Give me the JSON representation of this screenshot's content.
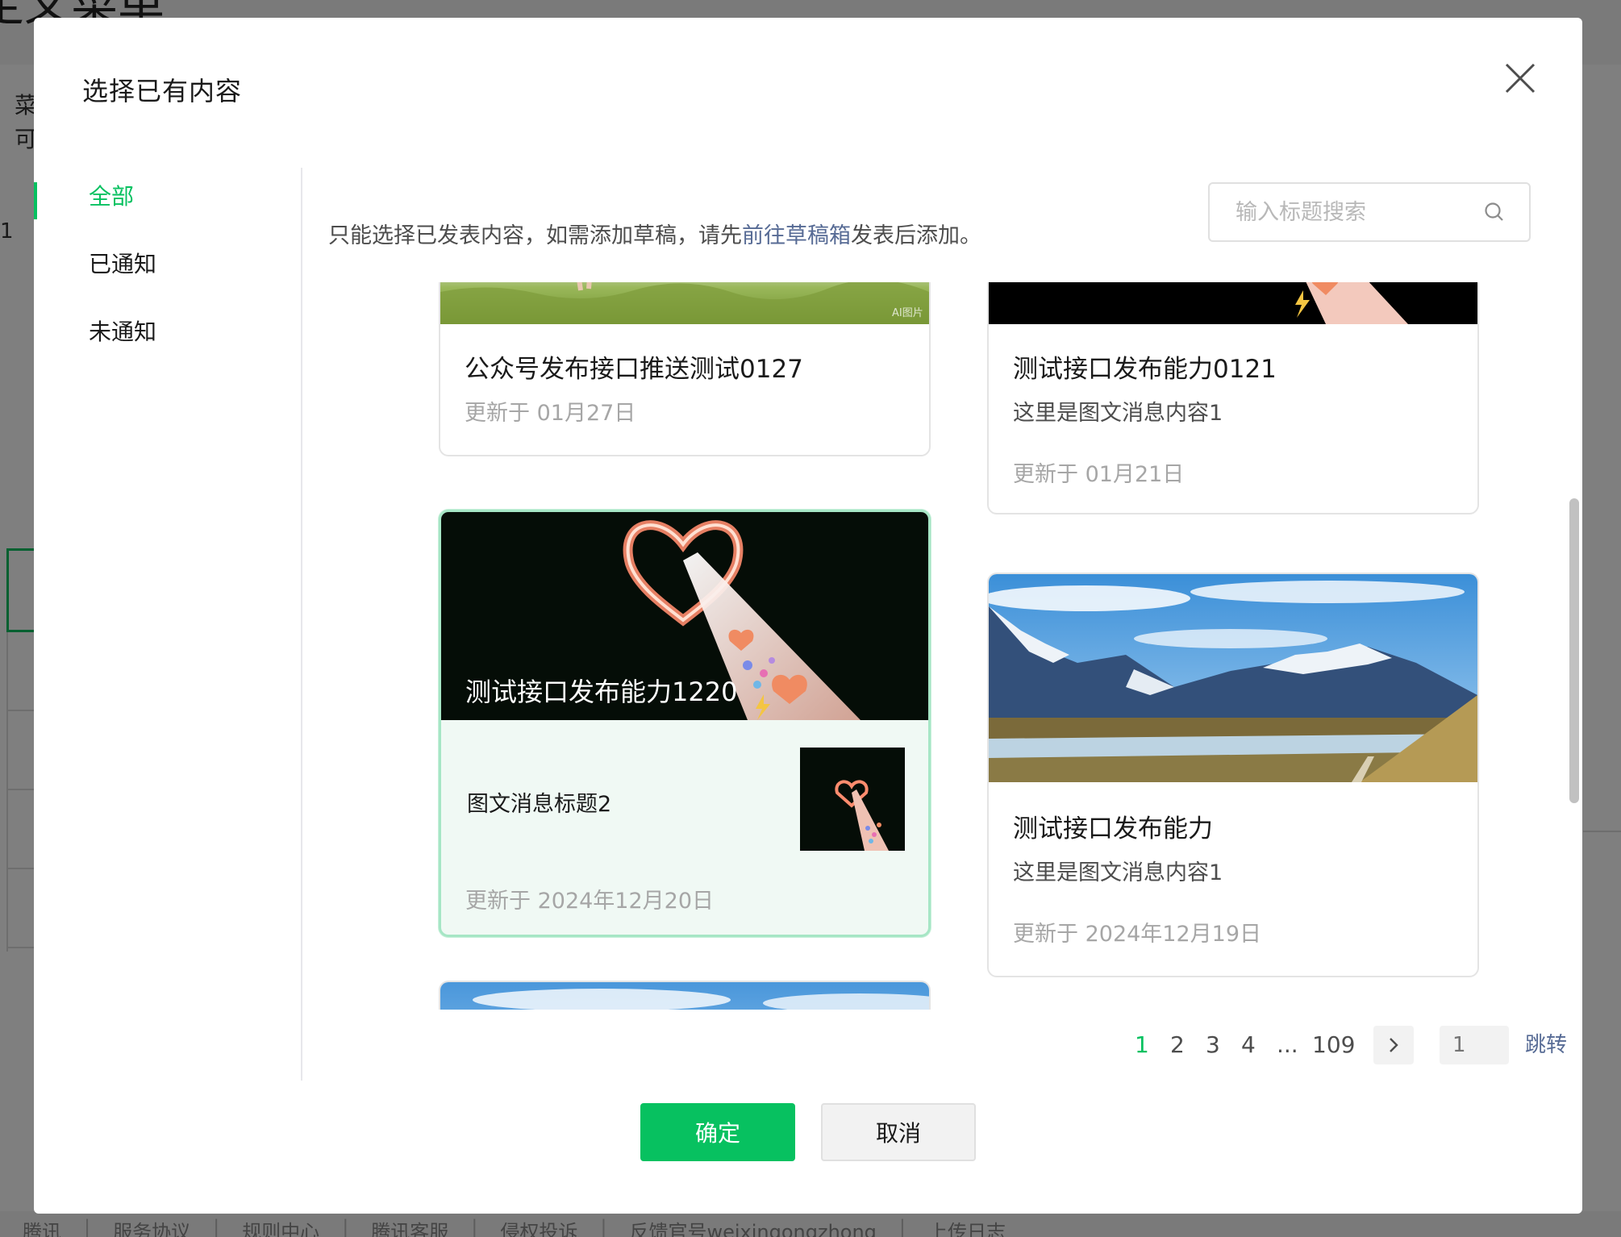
{
  "background": {
    "title_fragment": "定义菜单",
    "sidebar_fragments": [
      "菜",
      "可"
    ],
    "left_fragment": "1",
    "footer_links": [
      "腾讯",
      "服务协议",
      "规则中心",
      "腾讯客服",
      "侵权投诉",
      "反馈官号weixingongzhong",
      "上传日志"
    ]
  },
  "dialog": {
    "title": "选择已有内容",
    "close_icon": "close-icon",
    "tabs": [
      {
        "label": "全部",
        "active": true
      },
      {
        "label": "已通知",
        "active": false
      },
      {
        "label": "未通知",
        "active": false
      }
    ],
    "notice": {
      "before": "只能选择已发表内容，如需添加草稿，请先",
      "link": "前往草稿箱",
      "after": "发表后添加。"
    },
    "search": {
      "placeholder": "输入标题搜索",
      "value": "",
      "icon": "search-icon"
    },
    "cards": [
      {
        "title": "公众号发布接口推送测试0127",
        "digest": "",
        "date": "更新于 01月27日",
        "cover_badge": "AI图片",
        "cover": "grass-photo"
      },
      {
        "title": "测试接口发布能力0121",
        "digest": "这里是图文消息内容1",
        "date": "更新于 01月21日",
        "cover": "heart-beam-image"
      },
      {
        "title": "测试接口发布能力1220",
        "sub_item_title": "图文消息标题2",
        "date": "更新于 2024年12月20日",
        "selected": true,
        "cover": "heart-beam-image"
      },
      {
        "title": "测试接口发布能力",
        "digest": "这里是图文消息内容1",
        "date": "更新于 2024年12月19日",
        "cover": "mountain-lake-photo"
      },
      {
        "title": "",
        "cover": "sky-photo"
      }
    ],
    "pagination": {
      "pages": [
        "1",
        "2",
        "3",
        "4"
      ],
      "current": "1",
      "ellipsis": "...",
      "last": "109",
      "next_icon": "chevron-right-icon",
      "jump_placeholder": "1",
      "jump_label": "跳转"
    },
    "buttons": {
      "confirm": "确定",
      "cancel": "取消"
    }
  },
  "colors": {
    "accent": "#07c160",
    "link": "#576b95",
    "selected_bg": "#f0f9f4"
  }
}
